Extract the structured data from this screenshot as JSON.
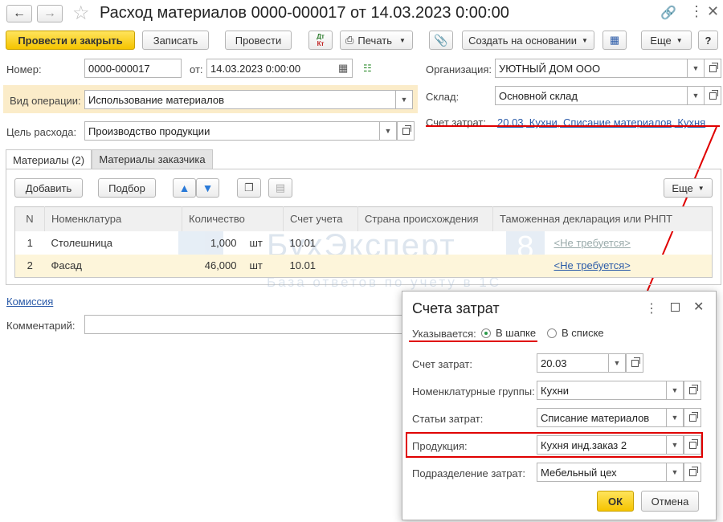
{
  "window": {
    "title": "Расход материалов 0000-000017 от 14.03.2023 0:00:00"
  },
  "toolbar": {
    "post_close": "Провести и закрыть",
    "save": "Записать",
    "post": "Провести",
    "dtkt_top": "Дт",
    "dtkt_bottom": "Кт",
    "print": "Печать",
    "create_based": "Создать на основании",
    "more": "Еще",
    "help": "?"
  },
  "form": {
    "number_label": "Номер:",
    "number": "0000-000017",
    "from_label": "от:",
    "date": "14.03.2023  0:00:00",
    "org_label": "Организация:",
    "org": "УЮТНЫЙ ДОМ ООО",
    "op_label": "Вид операции:",
    "op": "Использование материалов",
    "warehouse_label": "Склад:",
    "warehouse": "Основной склад",
    "purpose_label": "Цель расхода:",
    "purpose": "Производство продукции",
    "cost_account_label": "Счет затрат:",
    "cost_account": "20.03, Кухни, Списание материалов, Кухня"
  },
  "tabs": {
    "materials": "Материалы (2)",
    "customer_materials": "Материалы заказчика"
  },
  "table_toolbar": {
    "add": "Добавить",
    "pick": "Подбор",
    "more": "Еще"
  },
  "table": {
    "headers": [
      "N",
      "Номенклатура",
      "Количество",
      "Счет учета",
      "Страна происхождения",
      "Таможенная декларация или РНПТ"
    ],
    "rows": [
      {
        "n": "1",
        "name": "Столешница",
        "qty": "1,000",
        "unit": "шт",
        "account": "10.01",
        "customs": "<Не требуется>"
      },
      {
        "n": "2",
        "name": "Фасад",
        "qty": "46,000",
        "unit": "шт",
        "account": "10.01",
        "customs": "<Не требуется>"
      }
    ]
  },
  "watermark": {
    "brand": "БухЭксперт",
    "digit": "8",
    "tagline": "База ответов по учету в 1С"
  },
  "footer": {
    "commission": "Комиссия",
    "comment_label": "Комментарий:"
  },
  "dialog": {
    "title": "Счета затрат",
    "specified_label": "Указывается:",
    "opt_header": "В шапке",
    "opt_list": "В списке",
    "account_label": "Счет затрат:",
    "account": "20.03",
    "groups_label": "Номенклатурные группы:",
    "groups": "Кухни",
    "items_label": "Статьи затрат:",
    "items": "Списание материалов",
    "product_label": "Продукция:",
    "product": "Кухня инд.заказ 2",
    "dept_label": "Подразделение затрат:",
    "dept": "Мебельный цех",
    "ok": "ОК",
    "cancel": "Отмена"
  },
  "colors": {
    "accent_yellow": "#f5c400",
    "highlight_red": "#e00000",
    "link_blue": "#2a5aa8"
  }
}
